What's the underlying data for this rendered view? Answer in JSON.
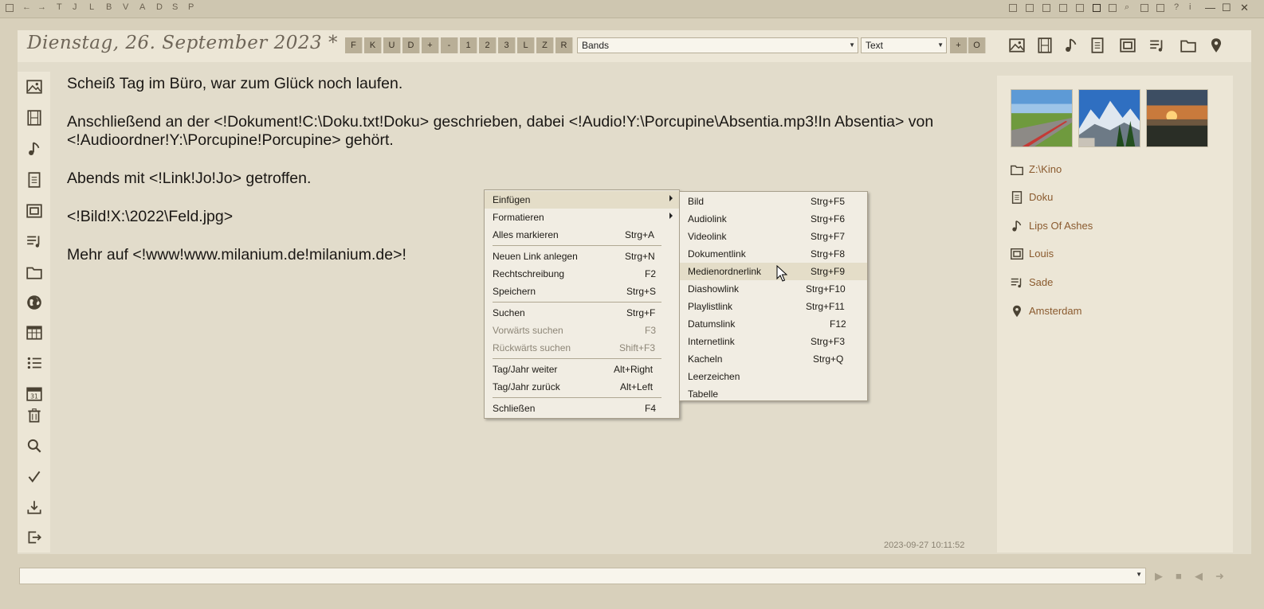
{
  "topbar": {
    "letters": [
      "T",
      "J",
      "L",
      "B",
      "V",
      "A",
      "D",
      "S",
      "P"
    ],
    "window_controls": [
      "—",
      "☐",
      "✕"
    ]
  },
  "header": {
    "date_title": "Dienstag, 26. September 2023 *",
    "format_buttons": [
      "F",
      "K",
      "U",
      "D",
      "+",
      "-",
      "1",
      "2",
      "3",
      "L",
      "Z",
      "R"
    ],
    "bands_combo": "Bands",
    "text_combo": "Text",
    "plus_button": "+",
    "circle_button": "O"
  },
  "editor": {
    "lines": [
      "Scheiß Tag im Büro, war zum Glück noch laufen.",
      "Anschließend an der <!Dokument!C:\\Doku.txt!Doku> geschrieben, dabei <!Audio!Y:\\Porcupine\\Absentia.mp3!In Absentia> von <!Audioordner!Y:\\Porcupine!Porcupine> gehört.",
      "Abends mit <!Link!Jo!Jo> getroffen.",
      "<!Bild!X:\\2022\\Feld.jpg>",
      "Mehr auf <!www!www.milanium.de!milanium.de>!"
    ],
    "timestamp": "2023-09-27 10:11:52"
  },
  "right_panel": {
    "items": [
      {
        "label": "Z:\\Kino",
        "icon": "folder-icon"
      },
      {
        "label": "Doku",
        "icon": "document-icon"
      },
      {
        "label": "Lips Of Ashes",
        "icon": "music-note-icon"
      },
      {
        "label": "Louis",
        "icon": "frame-icon"
      },
      {
        "label": "Sade",
        "icon": "playlist-icon"
      },
      {
        "label": "Amsterdam",
        "icon": "location-pin-icon"
      }
    ]
  },
  "context_menu": {
    "items": [
      {
        "label": "Einfügen",
        "shortcut": ""
      },
      {
        "label": "Formatieren",
        "shortcut": ""
      },
      {
        "label": "Alles markieren",
        "shortcut": "Strg+A"
      },
      {
        "label": "Neuen Link anlegen",
        "shortcut": "Strg+N"
      },
      {
        "label": "Rechtschreibung",
        "shortcut": "F2"
      },
      {
        "label": "Speichern",
        "shortcut": "Strg+S"
      },
      {
        "label": "Suchen",
        "shortcut": "Strg+F"
      },
      {
        "label": "Vorwärts suchen",
        "shortcut": "F3"
      },
      {
        "label": "Rückwärts suchen",
        "shortcut": "Shift+F3"
      },
      {
        "label": "Tag/Jahr weiter",
        "shortcut": "Alt+Right"
      },
      {
        "label": "Tag/Jahr zurück",
        "shortcut": "Alt+Left"
      },
      {
        "label": "Schließen",
        "shortcut": "F4"
      }
    ]
  },
  "submenu": {
    "items": [
      {
        "label": "Bild",
        "shortcut": "Strg+F5"
      },
      {
        "label": "Audiolink",
        "shortcut": "Strg+F6"
      },
      {
        "label": "Videolink",
        "shortcut": "Strg+F7"
      },
      {
        "label": "Dokumentlink",
        "shortcut": "Strg+F8"
      },
      {
        "label": "Medienordnerlink",
        "shortcut": "Strg+F9"
      },
      {
        "label": "Diashowlink",
        "shortcut": "Strg+F10"
      },
      {
        "label": "Playlistlink",
        "shortcut": "Strg+F11"
      },
      {
        "label": "Datumslink",
        "shortcut": "F12"
      },
      {
        "label": "Internetlink",
        "shortcut": "Strg+F3"
      },
      {
        "label": "Kacheln",
        "shortcut": "Strg+Q"
      },
      {
        "label": "Leerzeichen",
        "shortcut": ""
      },
      {
        "label": "Tabelle",
        "shortcut": ""
      }
    ]
  },
  "colors": {
    "background": "#d8d0bb",
    "panel": "#ece6d6",
    "accent_link": "#8a5a2e",
    "button": "#b9af97"
  }
}
